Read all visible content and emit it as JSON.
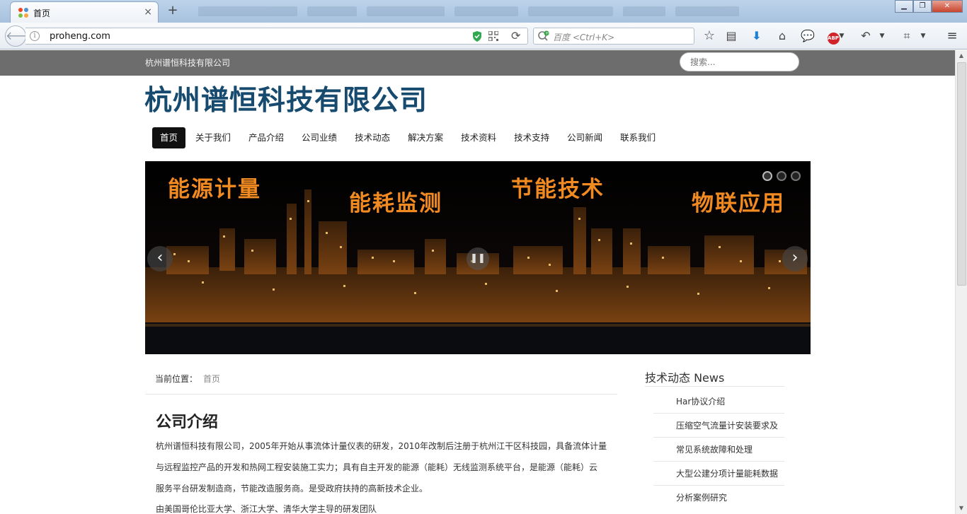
{
  "browser": {
    "tab_title": "首页",
    "tab_close": "×",
    "new_tab": "+",
    "url": "proheng.com",
    "search_placeholder": "百度 <Ctrl+K>",
    "icons": [
      "back-icon",
      "info-icon",
      "shield-icon",
      "qr-code-icon",
      "reload-icon",
      "search-engine-icon",
      "bookmark-star-icon",
      "reading-list-icon",
      "download-icon",
      "home-icon",
      "chat-icon",
      "adblock-icon",
      "undo-icon",
      "crop-icon",
      "menu-icon"
    ],
    "abp_label": "ABP"
  },
  "site": {
    "company_small": "杭州谱恒科技有限公司",
    "search_placeholder": "搜索...",
    "title": "杭州谱恒科技有限公司",
    "menu": [
      {
        "label": "首页",
        "active": true
      },
      {
        "label": "关于我们"
      },
      {
        "label": "产品介绍"
      },
      {
        "label": "公司业绩"
      },
      {
        "label": "技术动态"
      },
      {
        "label": "解决方案"
      },
      {
        "label": "技术资料"
      },
      {
        "label": "技术支持"
      },
      {
        "label": "公司新闻"
      },
      {
        "label": "联系我们"
      }
    ]
  },
  "banner": {
    "texts": [
      "能源计量",
      "能耗监测",
      "节能技术",
      "物联应用"
    ],
    "accent_color": "#f28a22",
    "slide_count": 3,
    "active_slide": 1
  },
  "breadcrumb": {
    "label": "当前位置：",
    "current": "首页"
  },
  "article": {
    "title": "公司介绍",
    "lines": [
      "杭州谱恒科技有限公司，2005年开始从事流体计量仪表的研发，2010年改制后注册于杭州江干区科技园，具备流体计量",
      "与远程监控产品的开发和热网工程安装施工实力；具有自主开发的能源（能耗）无线监测系统平台，是能源（能耗）云",
      "服务平台研发制造商，节能改造服务商。是受政府扶持的高新技术企业。"
    ],
    "next_line": "由美国哥伦比亚大学、浙江大学、清华大学主导的研发团队"
  },
  "sidebar": {
    "title": "技术动态 News",
    "items": [
      "Har协议介绍",
      "压缩空气流量计安装要求及",
      "常见系统故障和处理",
      "大型公建分项计量能耗数据",
      "分析案例研究"
    ]
  }
}
